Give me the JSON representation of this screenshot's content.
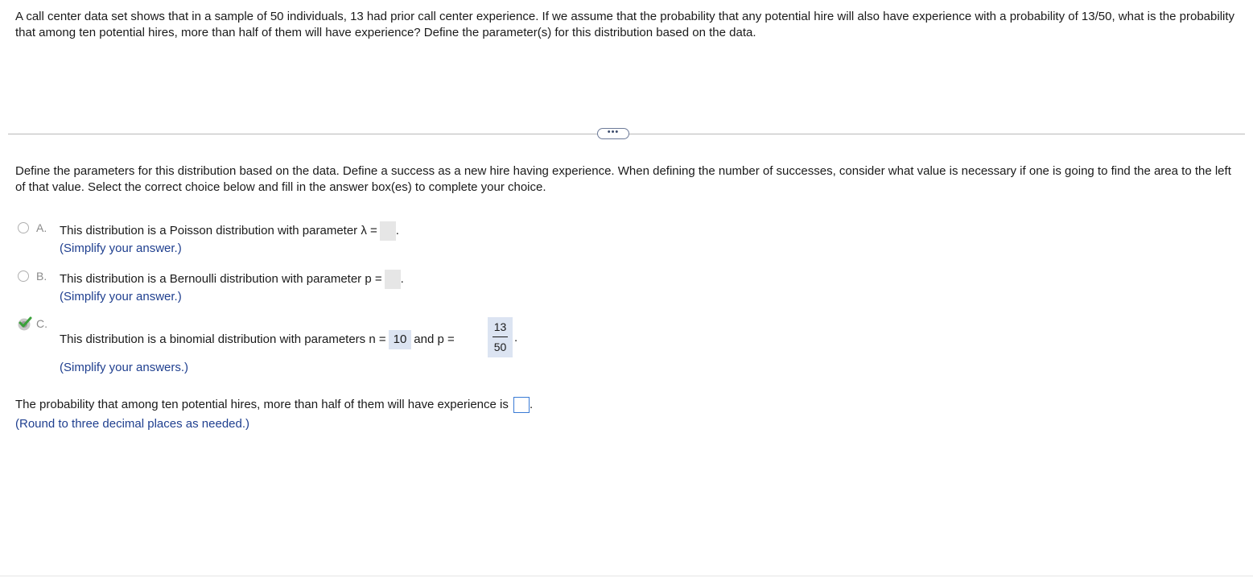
{
  "question": {
    "text": "A call center data set shows that in a sample of 50 individuals, 13 had prior call center experience. If we assume that the probability that any potential hire will also have experience with a probability of 13/50, what is the probability that among ten potential hires, more than half of them will have experience? Define the parameter(s) for this distribution based on the data."
  },
  "more_button": {
    "label": "•••"
  },
  "instructions": {
    "text": "Define the parameters for this distribution based on the data. Define a success as a new hire having experience. When defining the number of successes, consider what value is necessary if one is going to find the area to the left of that value. Select the correct choice below and fill in the answer box(es) to complete your choice."
  },
  "options": [
    {
      "letter": "A.",
      "text": "This distribution is a Poisson distribution with parameter λ =",
      "hint": "(Simplify your answer.)"
    },
    {
      "letter": "B.",
      "text": "This distribution is a Bernoulli distribution with parameter p =",
      "hint": "(Simplify your answer.)"
    },
    {
      "letter": "C.",
      "text_before": "This distribution is a binomial distribution with parameters n =",
      "n_value": "10",
      "text_mid": "and p =",
      "p_numerator": "13",
      "p_denominator": "50",
      "hint": "(Simplify your answers.)",
      "selected": true,
      "status": "correct"
    }
  ],
  "final_question": {
    "text": "The probability that among ten potential hires, more than half of them will have experience is",
    "hint": "(Round to three decimal places as needed.)"
  },
  "colors": {
    "hint": "#1f3f8f",
    "filled_answer_bg": "#dce4f2",
    "check_green": "#3aa13a",
    "input_border": "#3a7bd5"
  }
}
